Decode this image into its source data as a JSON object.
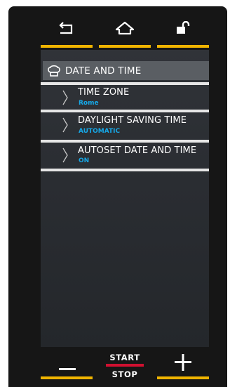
{
  "top_bar": {
    "back_icon": "back-arrow-icon",
    "home_icon": "home-icon",
    "lock_icon": "unlocked-padlock-icon"
  },
  "header": {
    "icon": "chef-hat-icon",
    "title": "DATE AND TIME"
  },
  "items": [
    {
      "label": "TIME ZONE",
      "value": "Rome"
    },
    {
      "label": "DAYLIGHT SAVING TIME",
      "value": "AUTOMATIC"
    },
    {
      "label": "AUTOSET DATE AND TIME",
      "value": "ON"
    }
  ],
  "bottom_bar": {
    "minus_icon": "minus-icon",
    "start_label": "START",
    "stop_label": "STOP",
    "plus_icon": "plus-icon"
  },
  "colors": {
    "accent": "#f0b400",
    "value_text": "#16a8e8",
    "start_stop_divider": "#d01030",
    "device_body": "#161616",
    "screen": "#2b2e33",
    "header": "#5a5e63"
  }
}
